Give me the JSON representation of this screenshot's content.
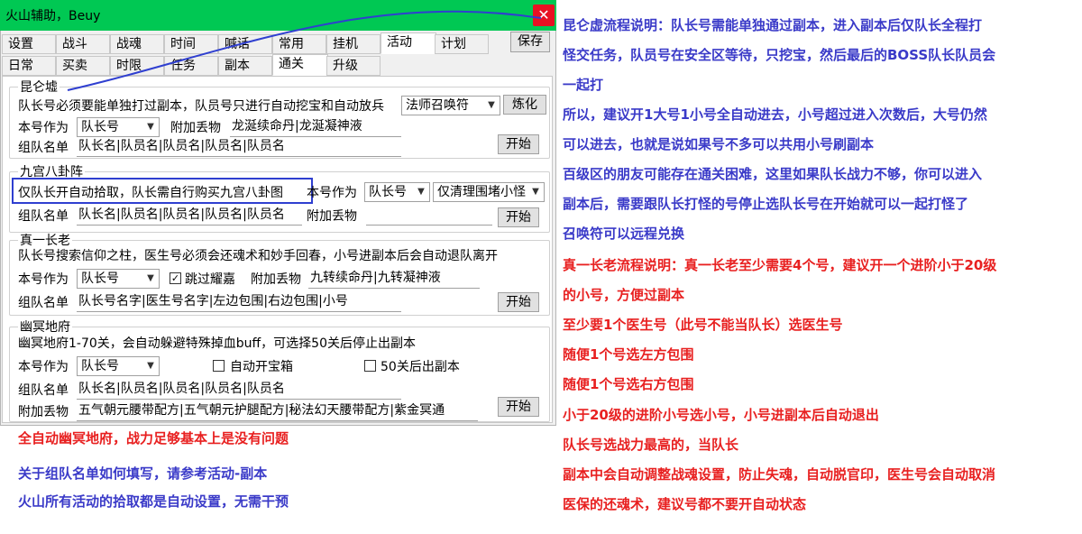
{
  "window": {
    "title": "火山辅助，Beuy",
    "close_glyph": "✕",
    "save_label": "保存"
  },
  "tabs_row1": [
    "设置",
    "战斗",
    "战魂",
    "时间",
    "喊话",
    "常用",
    "挂机",
    "活动",
    "计划"
  ],
  "tabs_row2": [
    "日常",
    "买卖",
    "时限",
    "任务",
    "副本",
    "通关",
    "升级"
  ],
  "active_tabs": {
    "row1": "活动",
    "row2": "通关"
  },
  "kunlun": {
    "group_label": "昆仑墟",
    "desc": "队长号必须要能单独打过副本，队员号只进行自动挖宝和自动放兵",
    "skill_select": "法师召唤符",
    "refine_label": "炼化",
    "role_label": "本号作为",
    "role_value": "队长号",
    "extra_label": "附加丢物",
    "extra_value": "龙涎续命丹|龙涎凝神液",
    "team_label": "组队名单",
    "team_value": "队长名|队员名|队员名|队员名|队员名",
    "start_label": "开始"
  },
  "jiugong": {
    "group_label": "九宫八卦阵",
    "desc": "仅队长开自动拾取，队长需自行购买九宫八卦图",
    "role_label": "本号作为",
    "role_value": "队长号",
    "mode_value": "仅清理围堵小怪",
    "team_label": "组队名单",
    "team_value": "队长名|队员名|队员名|队员名|队员名",
    "extra_label": "附加丢物",
    "extra_value": "",
    "start_label": "开始"
  },
  "zhenyi": {
    "group_label": "真一长老",
    "desc": "队长号搜索信仰之柱，医生号必须会还魂术和妙手回春，小号进副本后会自动退队离开",
    "role_label": "本号作为",
    "role_value": "队长号",
    "skip_label": "跳过耀嘉",
    "skip_checked": true,
    "extra_label": "附加丢物",
    "extra_value": "九转续命丹|九转凝神液",
    "team_label": "组队名单",
    "team_value": "队长号名字|医生号名字|左边包围|右边包围|小号",
    "start_label": "开始"
  },
  "youming": {
    "group_label": "幽冥地府",
    "desc": "幽冥地府1-70关，会自动躲避特殊掉血buff，可选择50关后停止出副本",
    "role_label": "本号作为",
    "role_value": "队长号",
    "auto_chest_label": "自动开宝箱",
    "stop50_label": "50关后出副本",
    "team_label": "组队名单",
    "team_value": "队长名|队员名|队员名|队员名|队员名",
    "extra_label": "附加丢物",
    "extra_value": "五气朝元腰带配方|五气朝元护腿配方|秘法幻天腰带配方|紫金冥通",
    "start_label": "开始"
  },
  "left_notes": [
    {
      "text": "全自动幽冥地府，战力足够基本上是没有问题",
      "color": "red"
    },
    {
      "text": "关于组队名单如何填写，请参考活动-副本",
      "color": "blue"
    },
    {
      "text": "火山所有活动的拾取都是自动设置，无需干预",
      "color": "blue"
    }
  ],
  "right_notes": [
    {
      "text": "昆仑虚流程说明：队长号需能单独通过副本，进入副本后仅队长全程打",
      "color": "blue"
    },
    {
      "text": "怪交任务，队员号在安全区等待，只挖宝，然后最后的BOSS队长队员会",
      "color": "blue"
    },
    {
      "text": "一起打",
      "color": "blue"
    },
    {
      "text": "所以，建议开1大号1小号全自动进去，小号超过进入次数后，大号仍然",
      "color": "blue"
    },
    {
      "text": "可以进去，也就是说如果号不多可以共用小号刷副本",
      "color": "blue"
    },
    {
      "text": "百级区的朋友可能存在通关困难，这里如果队长战力不够，你可以进入",
      "color": "blue"
    },
    {
      "text": "副本后，需要跟队长打怪的号停止选队长号在开始就可以一起打怪了",
      "color": "blue"
    },
    {
      "text": "召唤符可以远程兑换",
      "color": "blue"
    },
    {
      "text": "真一长老流程说明：真一长老至少需要4个号，建议开一个进阶小于20级",
      "color": "red"
    },
    {
      "text": "的小号，方便过副本",
      "color": "red"
    },
    {
      "text": "至少要1个医生号（此号不能当队长）选医生号",
      "color": "red"
    },
    {
      "text": "随便1个号选左方包围",
      "color": "red"
    },
    {
      "text": "随便1个号选右方包围",
      "color": "red"
    },
    {
      "text": "小于20级的进阶小号选小号，小号进副本后自动退出",
      "color": "red"
    },
    {
      "text": "队长号选战力最高的，当队长",
      "color": "red"
    },
    {
      "text": "副本中会自动调整战魂设置，防止失魂，自动脱官印，医生号会自动取消",
      "color": "red"
    },
    {
      "text": "医保的还魂术，建议号都不要开自动状态",
      "color": "red"
    }
  ],
  "colors": {
    "titlebar": "#00c853",
    "close": "#e81123",
    "blue_text": "#3a3ac8",
    "red_text": "#e82020",
    "annotation": "#2f3fd0"
  }
}
